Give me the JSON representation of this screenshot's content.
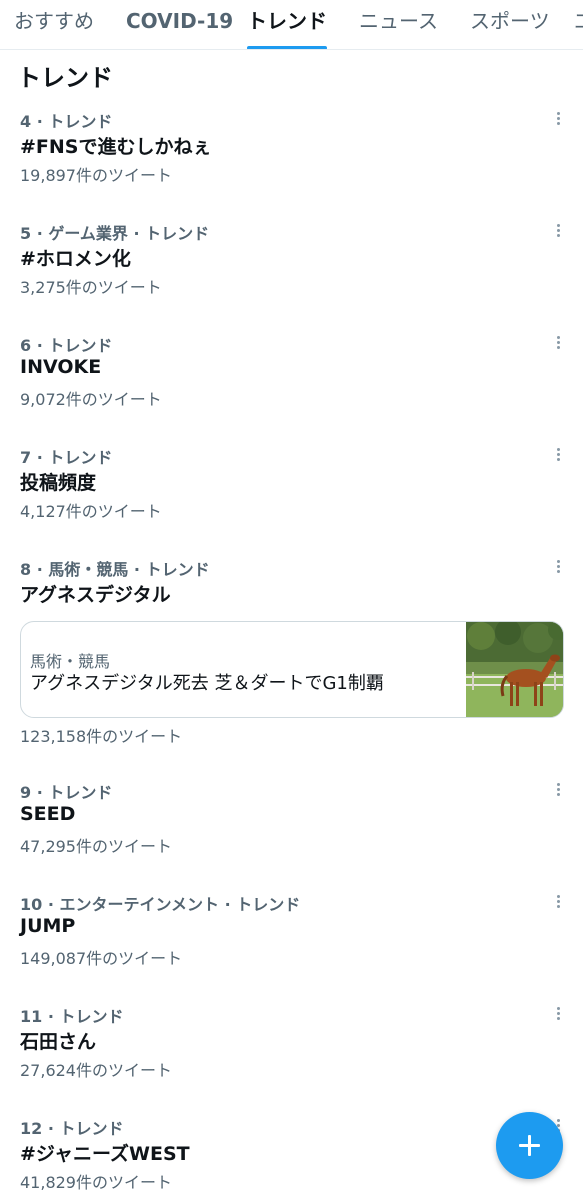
{
  "tabs": [
    "おすすめ",
    "COVID-19",
    "トレンド",
    "ニュース",
    "スポーツ",
    "エ"
  ],
  "section_title": "トレンド",
  "trends": [
    {
      "meta": "4 · トレンド",
      "name": "#FNSで進むしかねぇ",
      "count": "19,897件のツイート"
    },
    {
      "meta": "5 · ゲーム業界 · トレンド",
      "name": "#ホロメン化",
      "count": "3,275件のツイート"
    },
    {
      "meta": "6 · トレンド",
      "name": "INVOKE",
      "count": "9,072件のツイート"
    },
    {
      "meta": "7 · トレンド",
      "name": "投稿頻度",
      "count": "4,127件のツイート"
    },
    {
      "meta": "8 · 馬術・競馬 · トレンド",
      "name": "アグネスデジタル",
      "count": "123,158件のツイート"
    },
    {
      "meta": "9 · トレンド",
      "name": "SEED",
      "count": "47,295件のツイート"
    },
    {
      "meta": "10 · エンターテインメント · トレンド",
      "name": "JUMP",
      "count": "149,087件のツイート"
    },
    {
      "meta": "11 · トレンド",
      "name": "石田さん",
      "count": "27,624件のツイート"
    },
    {
      "meta": "12 · トレンド",
      "name": "#ジャニーズWEST",
      "count": "41,829件のツイート"
    }
  ],
  "news_card": {
    "category": "馬術・競馬",
    "title": "アグネスデジタル死去 芝＆ダートでG1制覇",
    "thumbnail": "horse-photo"
  },
  "icons": {
    "more": "more-vertical-icon",
    "compose": "plus-icon"
  },
  "colors": {
    "accent": "#1d9bf0",
    "text": "#0f1419",
    "secondary": "#536471",
    "border": "#cfd9de"
  }
}
